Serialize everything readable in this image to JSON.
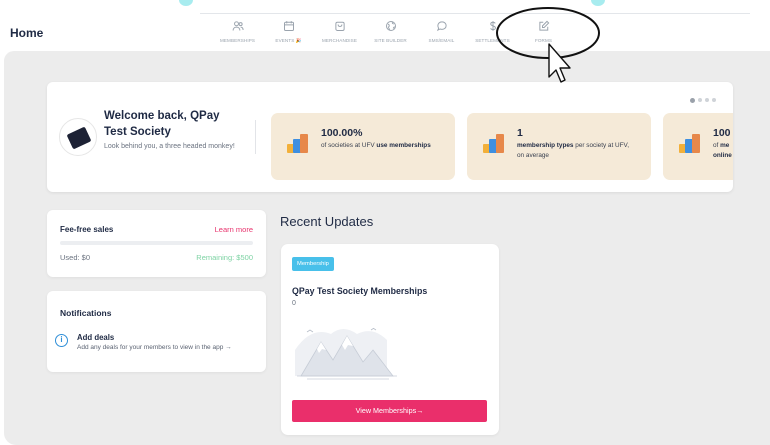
{
  "header": {
    "title": "Home",
    "nav": [
      {
        "label": "MEMBERSHIPS",
        "icon": "users-icon"
      },
      {
        "label": "EVENTS 🎉",
        "icon": "calendar-icon"
      },
      {
        "label": "MERCHANDISE",
        "icon": "shopping-bag-icon"
      },
      {
        "label": "SITE BUILDER",
        "icon": "globe-icon"
      },
      {
        "label": "SMS/EMAIL",
        "icon": "chat-icon"
      },
      {
        "label": "SETTLEMENTS",
        "icon": "dollar-icon"
      },
      {
        "label": "FORMS",
        "icon": "edit-form-icon"
      }
    ]
  },
  "welcome": {
    "title": "Welcome back, QPay Test Society",
    "subtitle": "Look behind you, a three headed monkey!",
    "carousel": {
      "count": 4,
      "active_index": 0
    }
  },
  "stats": [
    {
      "value": "100.00%",
      "desc_pre": "of societies at UFV ",
      "desc_bold": "use memberships",
      "desc_post": ""
    },
    {
      "value": "1",
      "desc_pre": "",
      "desc_bold": "membership types",
      "desc_post": " per society at UFV, on average"
    },
    {
      "value": "100",
      "desc_pre": "of ",
      "desc_bold": "me",
      "desc_post": "",
      "line2_bold": "online"
    }
  ],
  "fee_free": {
    "title": "Fee-free sales",
    "link": "Learn more",
    "used": "Used: $0",
    "remaining": "Remaining: $500",
    "progress": 0
  },
  "notifications": {
    "title": "Notifications",
    "items": [
      {
        "title": "Add deals",
        "body": "Add any deals for your members to view in the app →",
        "icon": "info-icon"
      }
    ]
  },
  "recent_updates": {
    "title": "Recent Updates",
    "cards": [
      {
        "badge": "Membership",
        "title": "QPay Test Society Memberships",
        "count": "0",
        "button": "View Memberships→"
      }
    ]
  },
  "colors": {
    "accent": "#ea2f6b",
    "badge": "#48c0ea",
    "stat_bg": "#f5ead8",
    "remaining": "#7ed3a4"
  }
}
